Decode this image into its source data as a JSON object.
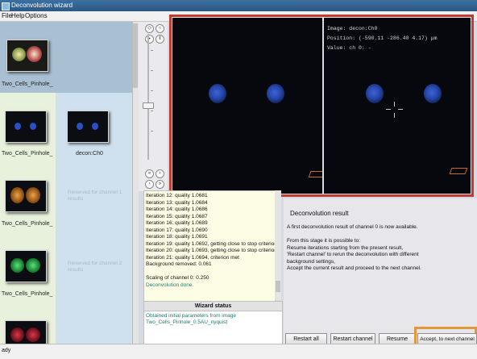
{
  "window": {
    "title": "Deconvolution wizard"
  },
  "menu": [
    "File",
    "Help",
    "Options"
  ],
  "channels": [
    {
      "caption": "Two_Cells_Pinhole_",
      "color": "#d8c98a",
      "selected": true
    },
    {
      "caption": "Two_Cells_Pinhole_",
      "color": "#2b4fc4",
      "result_caption": "decon:Ch0"
    },
    {
      "caption": "Two_Cells_Pinhole_",
      "color": "#c07a1c",
      "reserved": "Reserved for channel 1 results"
    },
    {
      "caption": "Two_Cells_Pinhole_",
      "color": "#1f9a3a",
      "reserved": "Reserved for channel 2 results"
    },
    {
      "caption": "",
      "color": "#9a1c2a",
      "reserved": ""
    }
  ],
  "toolbar": {
    "top_buttons": [
      "fit-icon",
      "zoom-icon",
      "play-icon",
      "pause-icon"
    ],
    "bottom_buttons": [
      "first-icon",
      "prev-icon",
      "next-icon",
      "last-icon"
    ]
  },
  "viewer_right": {
    "image_label": "Image: decon:Ch0",
    "position_label": "Position: (-590.11 -286.40 4.17) μm",
    "value_label": "Value: ch 0: -"
  },
  "log": {
    "lines": [
      "Iteration 12: quality 1.0681",
      "Iteration 13: quality 1.0684",
      "Iteration 14: quality 1.0686",
      "Iteration 15: quality 1.0687",
      "Iteration 16: quality 1.0689",
      "Iteration 17: quality 1.0690",
      "Iteration 18: quality 1.0691",
      "Iteration 19: quality 1.0692, getting close to stop criterion",
      "Iteration 20: quality 1.0693, getting close to stop criterion",
      "Iteration 21: quality 1.0694, criterion met",
      "Background removed: 0.061",
      "",
      "Scaling of channel 0: 0.250"
    ],
    "done": "Deconvolution done."
  },
  "wizard_status": {
    "title": "Wizard status",
    "line1": "Obtained initial parameters from image",
    "line2": "Two_Cells_Pinhole_0.5AU_nyquist"
  },
  "result": {
    "title": "Deconvolution result",
    "lines": [
      "A first deconvolution result of channel 0 is now available.",
      "",
      "From this stage it is possible to:",
      "    Resume iterations starting from the present result,",
      "    'Restart channel' to rerun the deconvolution with different",
      "    background settings,",
      "    Accept the current result and proceed to the next channel."
    ]
  },
  "buttons": {
    "restart_all": "Restart all",
    "restart_channel": "Restart channel",
    "resume": "Resume",
    "accept": "Accept, to next channel"
  },
  "statusbar": {
    "text": "ady"
  },
  "colors": {
    "highlight_view": "#c23b30",
    "highlight_accept": "#e59636"
  }
}
